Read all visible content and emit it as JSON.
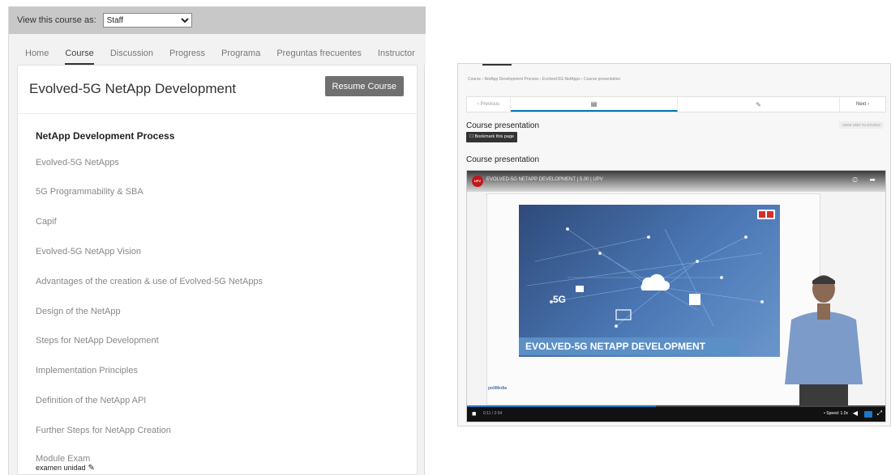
{
  "staff_bar": {
    "label": "View this course as:",
    "selected": "Staff"
  },
  "tabs": [
    "Home",
    "Course",
    "Discussion",
    "Progress",
    "Programa",
    "Preguntas frecuentes",
    "Instructor"
  ],
  "course": {
    "title": "Evolved-5G NetApp Development",
    "resume_label": "Resume Course",
    "section_title": "NetApp Development Process",
    "units": [
      "Evolved-5G NetApps",
      "5G Programmability & SBA",
      "Capif",
      "Evolved-5G NetApp Vision",
      "Advantages of the creation & use of Evolved-5G NetApps",
      "Design of the NetApp",
      "Steps for NetApp Development",
      "Implementation Principles",
      "Definition of the NetApp API",
      "Further Steps for NetApp Creation",
      "Module Exam"
    ],
    "subunit": "examen unidad"
  },
  "unit_view": {
    "breadcrumb": "Course › NetApp Development Process › Evolved-5G NetApps › Course presentation",
    "previous_label": "‹ Previous",
    "next_label": "Next ›",
    "heading": "Course presentation",
    "bookmark_label": "☐ Bookmark this page",
    "view_unit_label": "VIEW UNIT IN STUDIO",
    "component_heading": "Course presentation"
  },
  "video": {
    "title": "EVOLVED-5G NETAPP DEVELOPMENT | 5.00 | UPV",
    "logo_text": "UPV",
    "slide_title": "EVOLVED-5G NETAPP DEVELOPMENT",
    "slide_5g": "5G",
    "polimedia": "poliMedia",
    "time": "0:11 / 2:54",
    "speed": "• Speed: 1.0x",
    "progress_fraction": 0.45
  },
  "icons": {
    "seq_video": "▤",
    "seq_problem": "✎",
    "edit": "✎",
    "play": "■",
    "clock": "⏲",
    "share": "➦",
    "volume": "◀",
    "fullscreen": "⤢"
  }
}
